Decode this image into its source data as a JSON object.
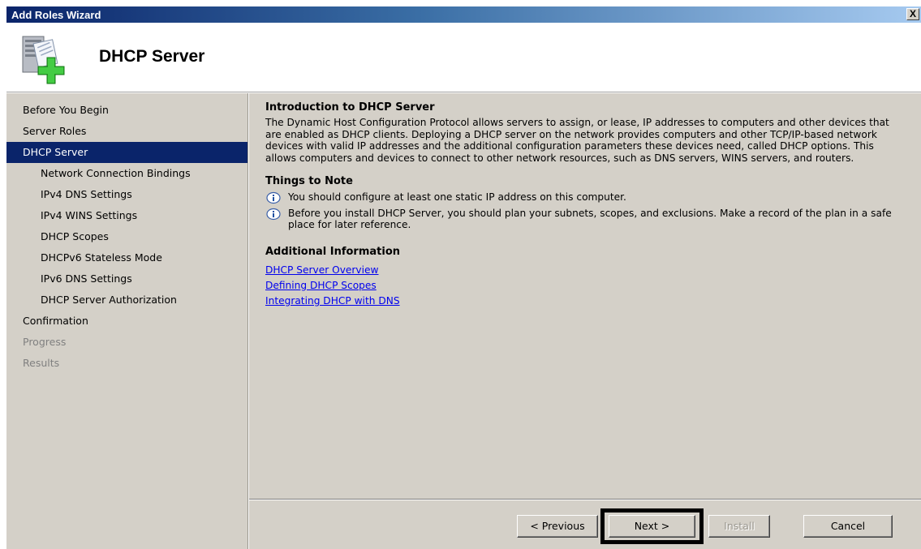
{
  "window": {
    "title": "Add Roles Wizard",
    "close_label": "X"
  },
  "header": {
    "title": "DHCP Server",
    "icon": "server-add-icon"
  },
  "sidebar": {
    "items": [
      {
        "label": "Before You Begin",
        "level": 0,
        "state": "normal"
      },
      {
        "label": "Server Roles",
        "level": 0,
        "state": "normal"
      },
      {
        "label": "DHCP Server",
        "level": 0,
        "state": "selected"
      },
      {
        "label": "Network Connection Bindings",
        "level": 1,
        "state": "normal"
      },
      {
        "label": "IPv4 DNS Settings",
        "level": 1,
        "state": "normal"
      },
      {
        "label": "IPv4 WINS Settings",
        "level": 1,
        "state": "normal"
      },
      {
        "label": "DHCP Scopes",
        "level": 1,
        "state": "normal"
      },
      {
        "label": "DHCPv6 Stateless Mode",
        "level": 1,
        "state": "normal"
      },
      {
        "label": "IPv6 DNS Settings",
        "level": 1,
        "state": "normal"
      },
      {
        "label": "DHCP Server Authorization",
        "level": 1,
        "state": "normal"
      },
      {
        "label": "Confirmation",
        "level": 0,
        "state": "normal"
      },
      {
        "label": "Progress",
        "level": 0,
        "state": "disabled"
      },
      {
        "label": "Results",
        "level": 0,
        "state": "disabled"
      }
    ]
  },
  "main": {
    "intro_heading": "Introduction to DHCP Server",
    "intro_text": "The Dynamic Host Configuration Protocol allows servers to assign, or lease, IP addresses to computers and other devices that are enabled as DHCP clients. Deploying a DHCP server on the network provides computers and other TCP/IP-based network devices with valid IP addresses and the additional configuration parameters these devices need, called DHCP options. This allows computers and devices to connect to other network resources, such as DNS servers, WINS servers, and routers.",
    "notes_heading": "Things to Note",
    "notes": [
      "You should configure at least one static IP address on this computer.",
      "Before you install DHCP Server, you should plan your subnets, scopes, and exclusions. Make a record of the plan in a safe place for later reference."
    ],
    "info_heading": "Additional Information",
    "links": [
      "DHCP Server Overview",
      "Defining DHCP Scopes",
      "Integrating DHCP with DNS"
    ]
  },
  "footer": {
    "previous_label": "< Previous",
    "next_label": "Next >",
    "install_label": "Install",
    "cancel_label": "Cancel"
  },
  "colors": {
    "selection": "#0a246a",
    "dialog_face": "#d4d0c8",
    "link": "#0000ee"
  }
}
